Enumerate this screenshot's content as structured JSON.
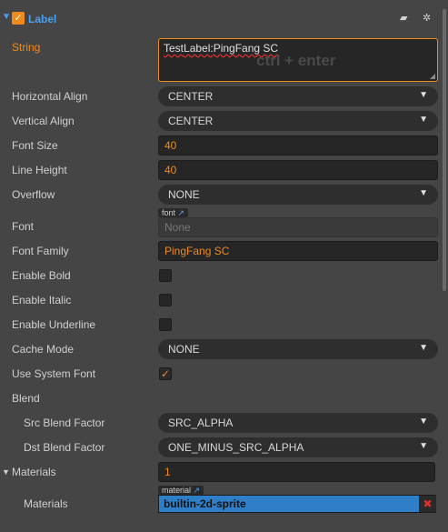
{
  "header": {
    "title": "Label",
    "enabled": true
  },
  "fields": {
    "string": {
      "label": "String",
      "value_underlined": "Test",
      "value_rest": "Label:PingFang SC",
      "hint": "ctrl + enter"
    },
    "horizontal_align": {
      "label": "Horizontal Align",
      "value": "CENTER"
    },
    "vertical_align": {
      "label": "Vertical Align",
      "value": "CENTER"
    },
    "font_size": {
      "label": "Font Size",
      "value": "40"
    },
    "line_height": {
      "label": "Line Height",
      "value": "40"
    },
    "overflow": {
      "label": "Overflow",
      "value": "NONE"
    },
    "font": {
      "label": "Font",
      "tag": "font",
      "value": "None"
    },
    "font_family": {
      "label": "Font Family",
      "value": "PingFang SC"
    },
    "enable_bold": {
      "label": "Enable Bold",
      "checked": false
    },
    "enable_italic": {
      "label": "Enable Italic",
      "checked": false
    },
    "enable_underline": {
      "label": "Enable Underline",
      "checked": false
    },
    "cache_mode": {
      "label": "Cache Mode",
      "value": "NONE"
    },
    "use_system_font": {
      "label": "Use System Font",
      "checked": true
    },
    "blend": {
      "label": "Blend"
    },
    "src_blend_factor": {
      "label": "Src Blend Factor",
      "value": "SRC_ALPHA"
    },
    "dst_blend_factor": {
      "label": "Dst Blend Factor",
      "value": "ONE_MINUS_SRC_ALPHA"
    },
    "materials_count": {
      "label": "Materials",
      "value": "1"
    },
    "materials_item": {
      "label": "Materials",
      "tag": "material",
      "value": "builtin-2d-sprite"
    }
  },
  "colors": {
    "accent": "#f08a1c",
    "title_blue": "#4aa0f0",
    "asset_blue": "#2f7ec8",
    "remove_red": "#e03030"
  }
}
